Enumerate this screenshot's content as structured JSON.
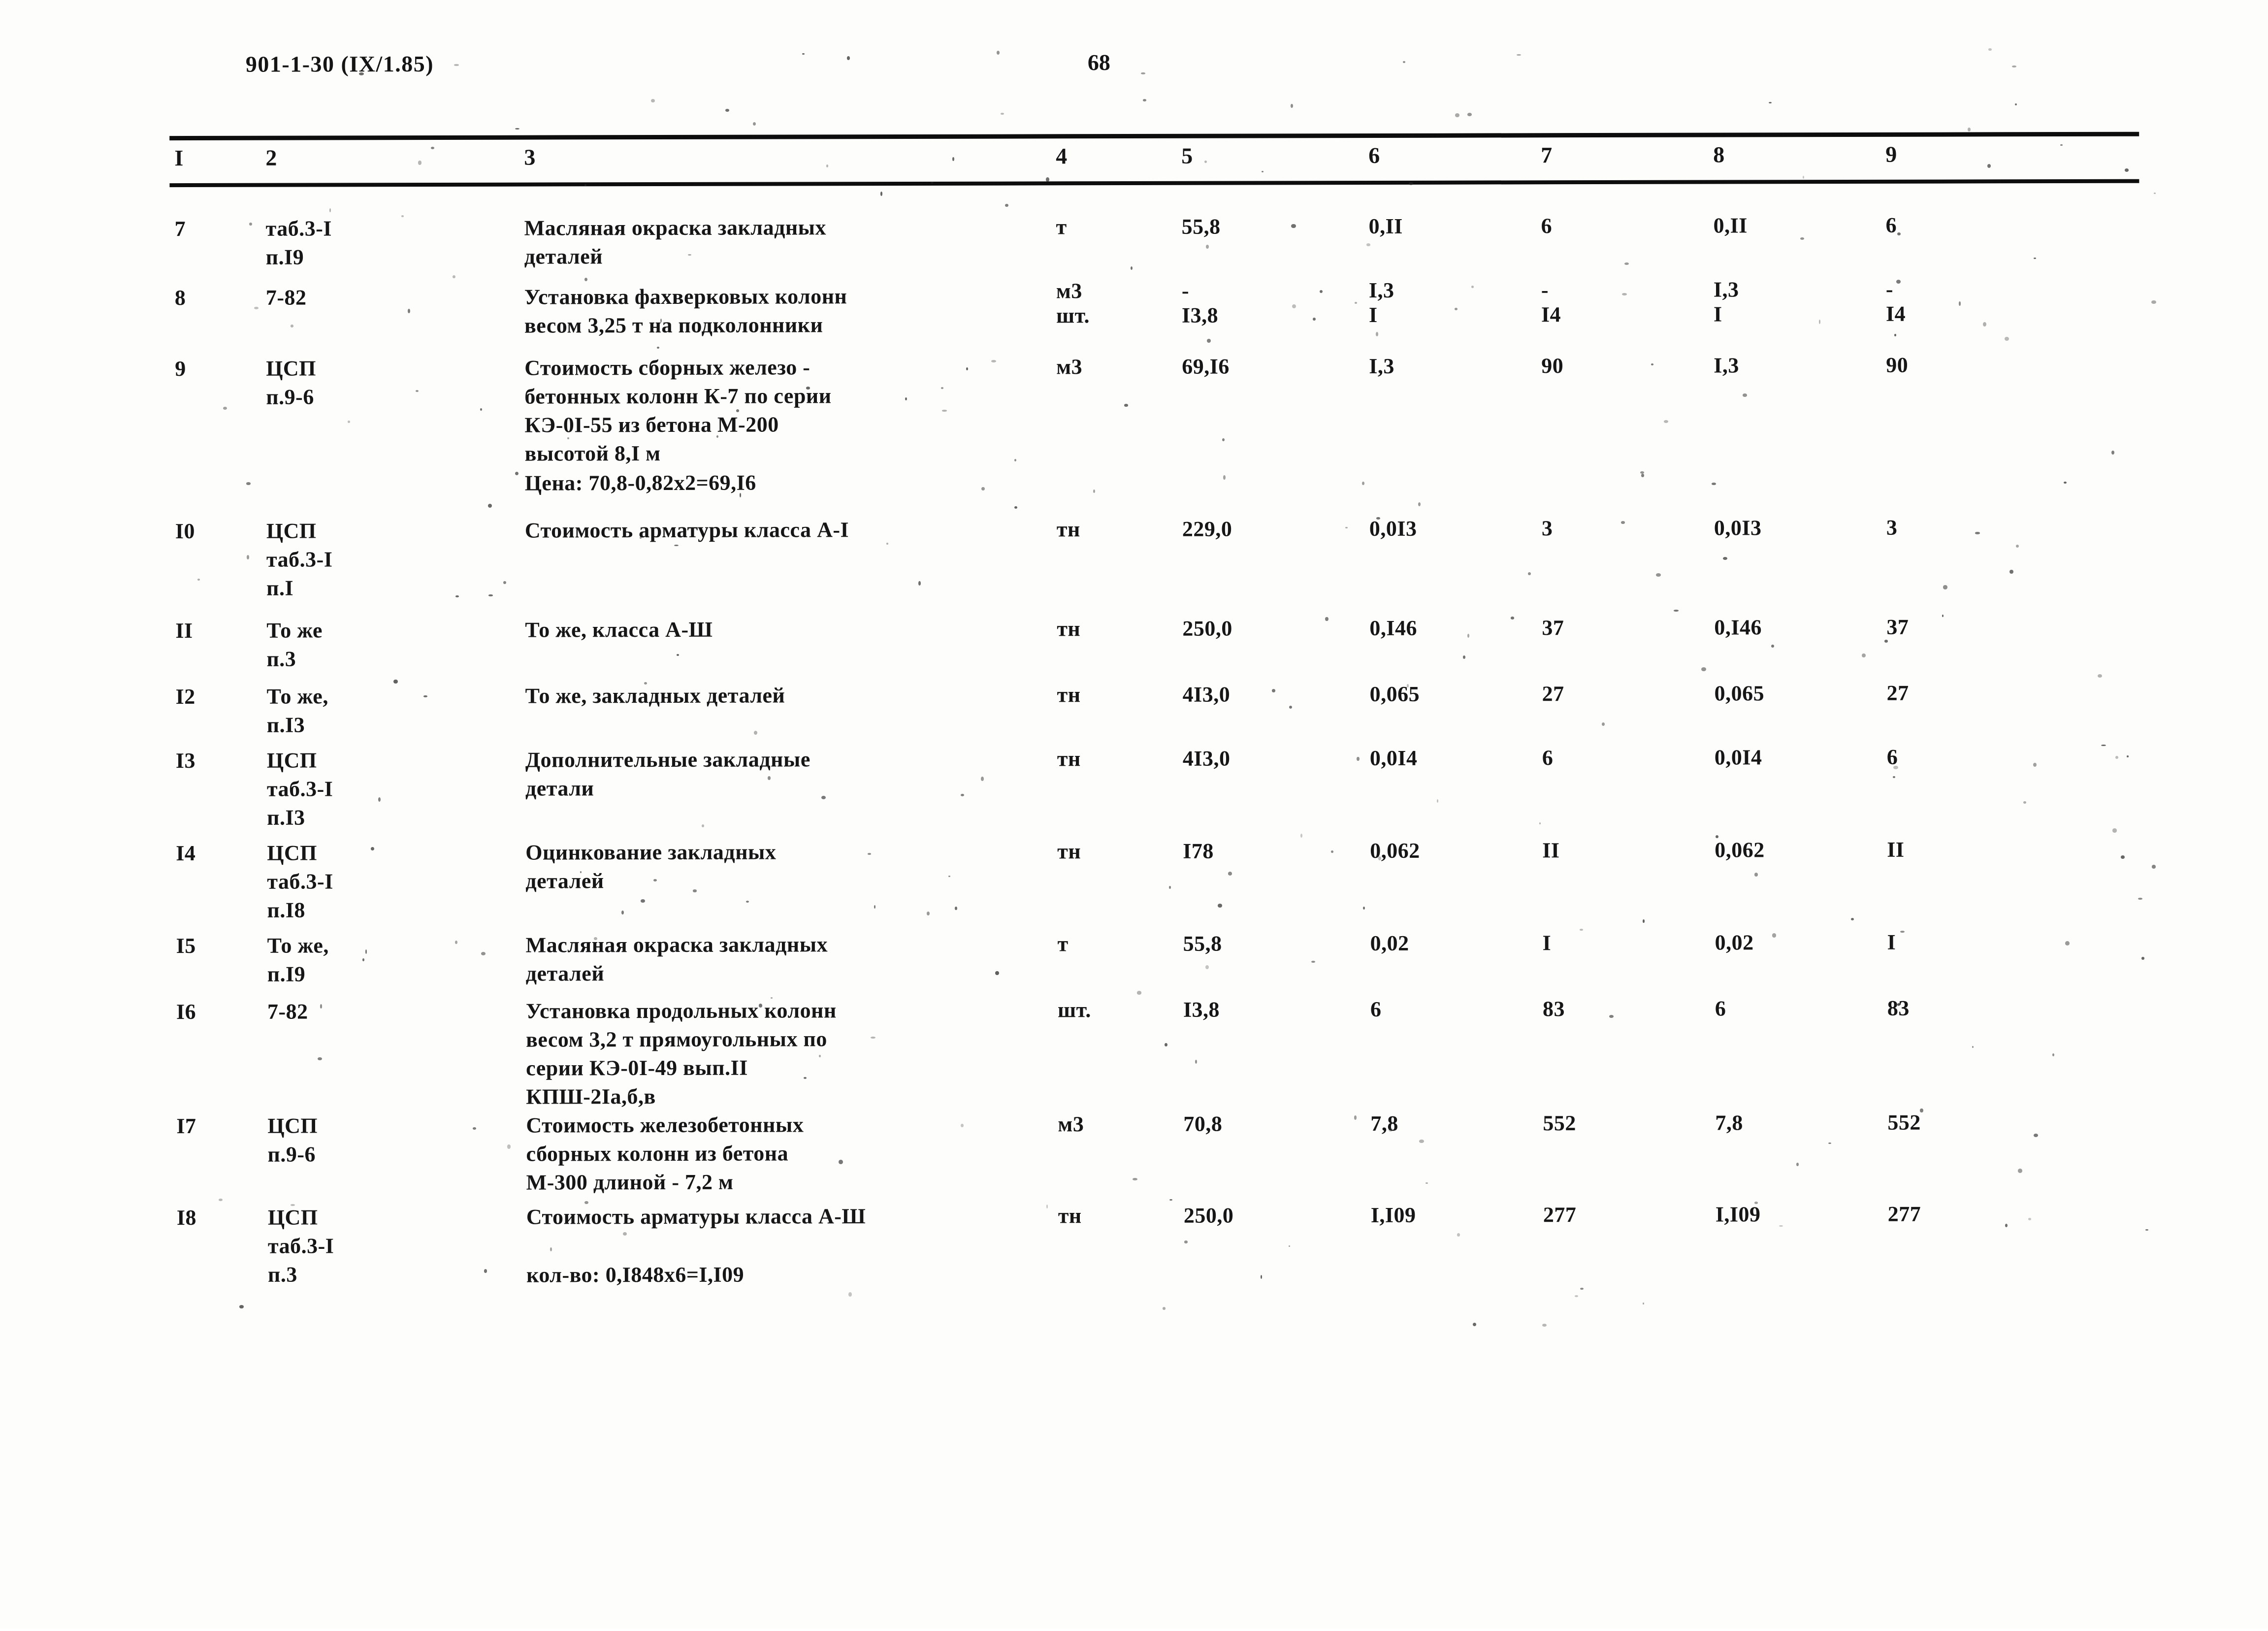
{
  "header": {
    "doc_code": "901-1-30 (IX/1.85)",
    "page_number": "68"
  },
  "table": {
    "column_headers": [
      "I",
      "2",
      "3",
      "4",
      "5",
      "6",
      "7",
      "8",
      "9"
    ],
    "rows": [
      {
        "num": "7",
        "ref": "таб.3-I\nп.I9",
        "desc": "Масляная окраска закладных\nдеталей",
        "unit": "т",
        "c5": "55,8",
        "c6": "0,II",
        "c7": "6",
        "c8": "0,II",
        "c9": "6"
      },
      {
        "num": "8",
        "ref": "7-82",
        "desc": "Установка фахверковых колонн\nвесом 3,25 т на подколонники",
        "unit_num": "м3",
        "unit_den": "шт.",
        "c5_num": "-",
        "c5_den": "I3,8",
        "c6_num": "I,3",
        "c6_den": "I",
        "c7_num": "-",
        "c7_den": "I4",
        "c8_num": "I,3",
        "c8_den": "I",
        "c9_num": "-",
        "c9_den": "I4"
      },
      {
        "num": "9",
        "ref": "ЦСП\nп.9-6",
        "desc": "Стоимость сборных железо -\nбетонных колонн К-7 по серии\nКЭ-0I-55  из бетона М-200\nвысотой 8,I м",
        "unit": "м3",
        "c5": "69,I6",
        "c6": "I,3",
        "c7": "90",
        "c8": "I,3",
        "c9": "90",
        "note": "Цена: 70,8-0,82х2=69,I6"
      },
      {
        "num": "I0",
        "ref": "ЦСП\nтаб.3-I\nп.I",
        "desc": "Стоимость арматуры класса А-I",
        "unit": "тн",
        "c5": "229,0",
        "c6": "0,0I3",
        "c7": "3",
        "c8": "0,0I3",
        "c9": "3"
      },
      {
        "num": "II",
        "ref": "То же\nп.3",
        "desc": "То же, класса А-Ш",
        "unit": "тн",
        "c5": "250,0",
        "c6": "0,I46",
        "c7": "37",
        "c8": "0,I46",
        "c9": "37"
      },
      {
        "num": "I2",
        "ref": "То же,\nп.I3",
        "desc": "То же, закладных деталей",
        "unit": "тн",
        "c5": "4I3,0",
        "c6": "0,065",
        "c7": "27",
        "c8": "0,065",
        "c9": "27"
      },
      {
        "num": "I3",
        "ref": "ЦСП\nтаб.3-I\nп.I3",
        "desc": "Дополнительные закладные\nдетали",
        "unit": "тн",
        "c5": "4I3,0",
        "c6": "0,0I4",
        "c7": "6",
        "c8": "0,0I4",
        "c9": "6"
      },
      {
        "num": "I4",
        "ref": "ЦСП\nтаб.3-I\nп.I8",
        "desc": "Оцинкование закладных\nдеталей",
        "unit": "тн",
        "c5": "I78",
        "c6": "0,062",
        "c7": "II",
        "c8": "0,062",
        "c9": "II"
      },
      {
        "num": "I5",
        "ref": "То же,\nп.I9",
        "desc": "Масляная окраска закладных\nдеталей",
        "unit": "т",
        "c5": "55,8",
        "c6": "0,02",
        "c7": "I",
        "c8": "0,02",
        "c9": "I"
      },
      {
        "num": "I6",
        "ref": "7-82",
        "desc": "Установка продольных колонн\nвесом 3,2 т прямоугольных по\nсерии КЭ-0I-49 вып.II\nКПШ-2Iа,б,в",
        "unit": "шт.",
        "c5": "I3,8",
        "c6": "6",
        "c7": "83",
        "c8": "6",
        "c9": "83"
      },
      {
        "num": "I7",
        "ref": "ЦСП\nп.9-6",
        "desc": "Стоимость железобетонных\nсборных колонн из бетона\nМ-300 длиной - 7,2 м",
        "unit": "м3",
        "c5": "70,8",
        "c6": "7,8",
        "c7": "552",
        "c8": "7,8",
        "c9": "552"
      },
      {
        "num": "I8",
        "ref": "ЦСП\nтаб.3-I\nп.3",
        "desc": "Стоимость арматуры класса А-Ш",
        "unit": "тн",
        "c5": "250,0",
        "c6": "I,I09",
        "c7": "277",
        "c8": "I,I09",
        "c9": "277",
        "note": "кол-во: 0,I848х6=I,I09"
      }
    ]
  }
}
